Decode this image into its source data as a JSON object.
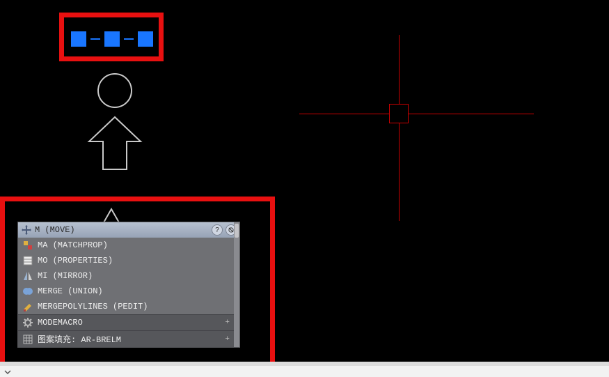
{
  "colors": {
    "highlight": "#e81010",
    "grip": "#1976ff",
    "crosshair": "#c00000"
  },
  "popup": {
    "header_title": "M (MOVE)",
    "help_tooltip": "?",
    "settings_tooltip": "⚙",
    "commands": [
      {
        "icon": "matchprop-icon",
        "label": "MA (MATCHPROP)"
      },
      {
        "icon": "properties-icon",
        "label": "MO (PROPERTIES)"
      },
      {
        "icon": "mirror-icon",
        "label": "MI (MIRROR)"
      },
      {
        "icon": "union-icon",
        "label": "MERGE (UNION)"
      },
      {
        "icon": "pedit-icon",
        "label": "MERGEPOLYLINES (PEDIT)"
      }
    ],
    "categories": [
      {
        "icon": "gear-icon",
        "label": "MODEMACRO",
        "expand": "+"
      },
      {
        "icon": "hatch-icon",
        "label": "图案填充: AR-BRELM",
        "expand": "+"
      }
    ]
  }
}
